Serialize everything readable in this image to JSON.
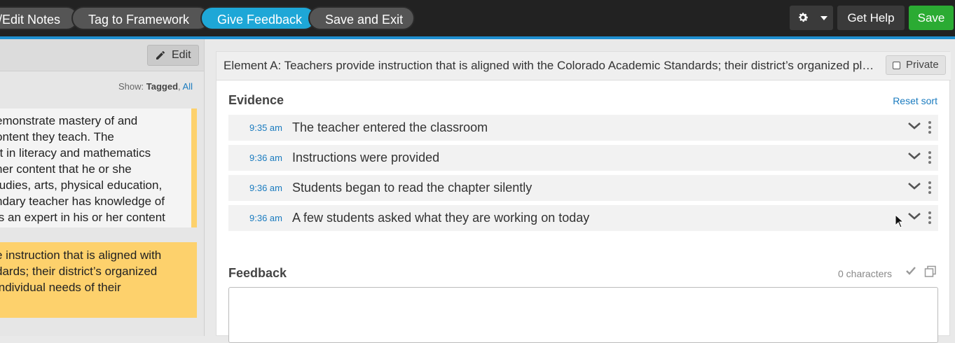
{
  "colors": {
    "accent": "#1ea7d7",
    "save": "#2bab33",
    "highlight": "#fdd16c",
    "link": "#1a7bbf"
  },
  "topbar": {
    "steps": [
      {
        "label": "/Edit Notes",
        "active": false
      },
      {
        "label": "Tag to Framework",
        "active": false
      },
      {
        "label": "Give Feedback",
        "active": true
      },
      {
        "label": "Save and Exit",
        "active": false
      }
    ],
    "settings_icon": "gear-icon",
    "help_label": "Get Help",
    "save_label": "Save"
  },
  "left_panel": {
    "edit_label": "Edit",
    "show_label": "Show:",
    "show_tagged": "Tagged",
    "show_sep": ",",
    "show_all": "All",
    "card_lines": [
      "emonstrate mastery of and",
      "ontent they teach. The",
      "rt in literacy and mathematics",
      "her content that he or she",
      "tudies, arts, physical education,",
      "ndary teacher has knowledge of",
      "is an expert in his or her content"
    ],
    "highlight_lines": [
      "e instruction that is aligned with",
      "dards; their district’s organized",
      "individual needs of their"
    ]
  },
  "main": {
    "element_title": "Element A: Teachers provide instruction that is aligned with the Colorado Academic Standards; their district’s organized plan of instruction; and the individual needs of their students.",
    "private_label": "Private",
    "evidence_title": "Evidence",
    "reset_sort": "Reset sort",
    "evidence": [
      {
        "time": "9:35 am",
        "text": "The teacher entered the classroom"
      },
      {
        "time": "9:36 am",
        "text": "Instructions were provided"
      },
      {
        "time": "9:36 am",
        "text": "Students began to read the chapter silently"
      },
      {
        "time": "9:36 am",
        "text": "A few students asked what they are working on today"
      }
    ],
    "feedback_title": "Feedback",
    "char_count": "0 characters"
  }
}
